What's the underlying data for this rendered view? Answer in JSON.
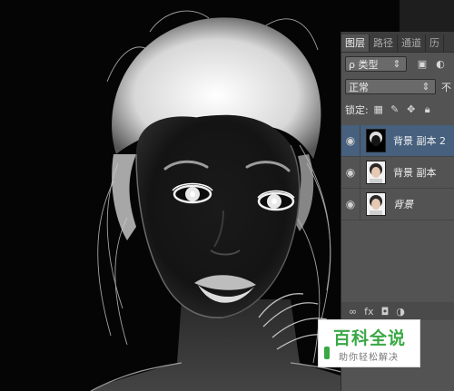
{
  "panel": {
    "tabs": [
      "图层",
      "路径",
      "通道",
      "历"
    ],
    "filter": {
      "label": "ρ 类型",
      "icons": [
        "image-filter-icon",
        "adjustment-filter-icon"
      ]
    },
    "blend_mode": "正常",
    "opacity_label": "不",
    "lock_label": "锁定:",
    "layers": [
      {
        "name": "背景 副本 2",
        "selected": true,
        "thumbnail": "inverted"
      },
      {
        "name": "背景 副本",
        "selected": false,
        "thumbnail": "normal"
      },
      {
        "name": "背景",
        "selected": false,
        "thumbnail": "normal"
      }
    ],
    "bottom_icons": [
      "∞",
      "fx"
    ]
  },
  "watermark": {
    "title": "百科全说",
    "subtitle": "助你轻松解决",
    "color": "#39a845"
  }
}
